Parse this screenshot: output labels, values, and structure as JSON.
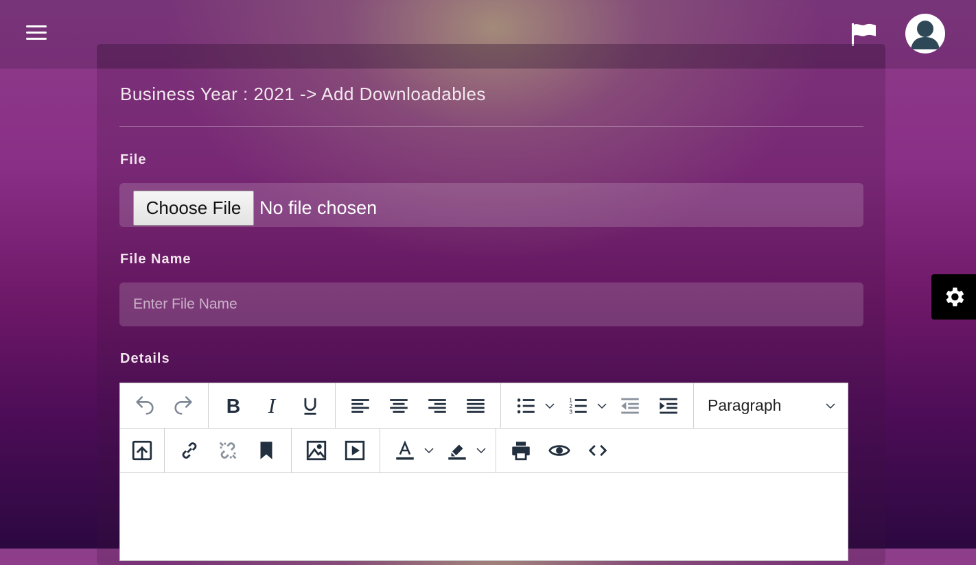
{
  "header": {
    "menu_icon": "hamburger-icon",
    "flag_icon": "flag-icon",
    "avatar_icon": "user-avatar-icon"
  },
  "page": {
    "title": "Business Year : 2021 -> Add Downloadables"
  },
  "form": {
    "file_label": "File",
    "choose_file_label": "Choose File",
    "no_file_text": "No file chosen",
    "file_name_label": "File Name",
    "file_name_placeholder": "Enter File Name",
    "file_name_value": "",
    "details_label": "Details"
  },
  "editor": {
    "toolbar_row1": [
      "undo-icon",
      "redo-icon",
      "bold-icon",
      "italic-icon",
      "underline-icon",
      "align-left-icon",
      "align-center-icon",
      "align-right-icon",
      "align-justify-icon",
      "bullet-list-icon",
      "numbered-list-icon",
      "outdent-icon",
      "indent-icon"
    ],
    "block_format_value": "Paragraph",
    "toolbar_row2": [
      "upload-icon",
      "link-icon",
      "unlink-icon",
      "bookmark-icon",
      "image-icon",
      "media-icon",
      "text-color-icon",
      "highlight-icon",
      "print-icon",
      "preview-icon",
      "code-icon"
    ],
    "content": ""
  },
  "settings_tab_icon": "gear-icon",
  "colors": {
    "accent": "#8a2f86",
    "editor_icon": "#222f3e",
    "settings_tab": "#000000"
  }
}
